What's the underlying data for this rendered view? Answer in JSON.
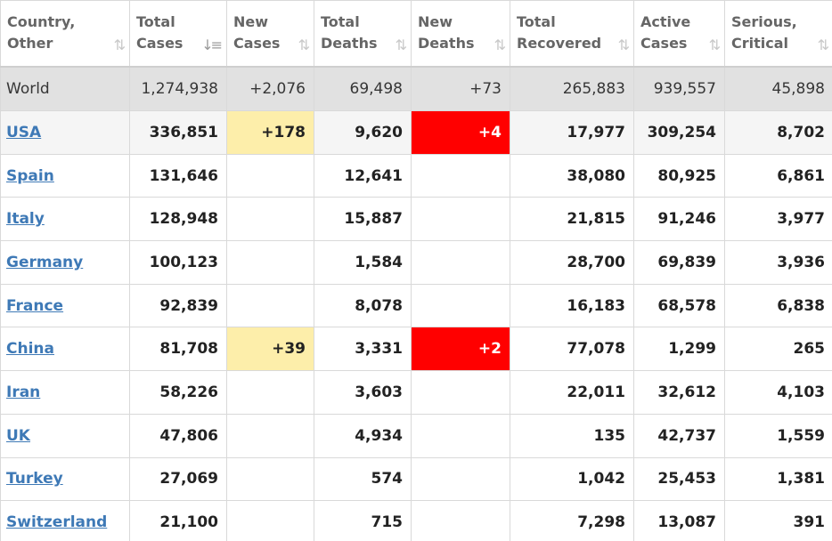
{
  "headers": [
    {
      "line1": "Country,",
      "line2": "Other",
      "sort": "⇅",
      "active": false
    },
    {
      "line1": "Total",
      "line2": "Cases",
      "sort": "↓≡",
      "active": true
    },
    {
      "line1": "New",
      "line2": "Cases",
      "sort": "⇅",
      "active": false
    },
    {
      "line1": "Total",
      "line2": "Deaths",
      "sort": "⇅",
      "active": false
    },
    {
      "line1": "New",
      "line2": "Deaths",
      "sort": "⇅",
      "active": false
    },
    {
      "line1": "Total",
      "line2": "Recovered",
      "sort": "⇅",
      "active": false
    },
    {
      "line1": "Active",
      "line2": "Cases",
      "sort": "⇅",
      "active": false
    },
    {
      "line1": "Serious,",
      "line2": "Critical",
      "sort": "⇅",
      "active": false
    }
  ],
  "world": {
    "country": "World",
    "total_cases": "1,274,938",
    "new_cases": "+2,076",
    "total_deaths": "69,498",
    "new_deaths": "+73",
    "total_recovered": "265,883",
    "active_cases": "939,557",
    "serious": "45,898"
  },
  "rows": [
    {
      "country": "USA",
      "total_cases": "336,851",
      "new_cases": "+178",
      "total_deaths": "9,620",
      "new_deaths": "+4",
      "total_recovered": "17,977",
      "active_cases": "309,254",
      "serious": "8,702"
    },
    {
      "country": "Spain",
      "total_cases": "131,646",
      "new_cases": "",
      "total_deaths": "12,641",
      "new_deaths": "",
      "total_recovered": "38,080",
      "active_cases": "80,925",
      "serious": "6,861"
    },
    {
      "country": "Italy",
      "total_cases": "128,948",
      "new_cases": "",
      "total_deaths": "15,887",
      "new_deaths": "",
      "total_recovered": "21,815",
      "active_cases": "91,246",
      "serious": "3,977"
    },
    {
      "country": "Germany",
      "total_cases": "100,123",
      "new_cases": "",
      "total_deaths": "1,584",
      "new_deaths": "",
      "total_recovered": "28,700",
      "active_cases": "69,839",
      "serious": "3,936"
    },
    {
      "country": "France",
      "total_cases": "92,839",
      "new_cases": "",
      "total_deaths": "8,078",
      "new_deaths": "",
      "total_recovered": "16,183",
      "active_cases": "68,578",
      "serious": "6,838"
    },
    {
      "country": "China",
      "total_cases": "81,708",
      "new_cases": "+39",
      "total_deaths": "3,331",
      "new_deaths": "+2",
      "total_recovered": "77,078",
      "active_cases": "1,299",
      "serious": "265"
    },
    {
      "country": "Iran",
      "total_cases": "58,226",
      "new_cases": "",
      "total_deaths": "3,603",
      "new_deaths": "",
      "total_recovered": "22,011",
      "active_cases": "32,612",
      "serious": "4,103"
    },
    {
      "country": "UK",
      "total_cases": "47,806",
      "new_cases": "",
      "total_deaths": "4,934",
      "new_deaths": "",
      "total_recovered": "135",
      "active_cases": "42,737",
      "serious": "1,559"
    },
    {
      "country": "Turkey",
      "total_cases": "27,069",
      "new_cases": "",
      "total_deaths": "574",
      "new_deaths": "",
      "total_recovered": "1,042",
      "active_cases": "25,453",
      "serious": "1,381"
    },
    {
      "country": "Switzerland",
      "total_cases": "21,100",
      "new_cases": "",
      "total_deaths": "715",
      "new_deaths": "",
      "total_recovered": "7,298",
      "active_cases": "13,087",
      "serious": "391"
    }
  ],
  "colors": {
    "link": "#3e79b6",
    "new_cases_highlight": "#fdeeaa",
    "new_deaths_highlight": "#ff0000",
    "world_row": "#e1e1e1"
  }
}
